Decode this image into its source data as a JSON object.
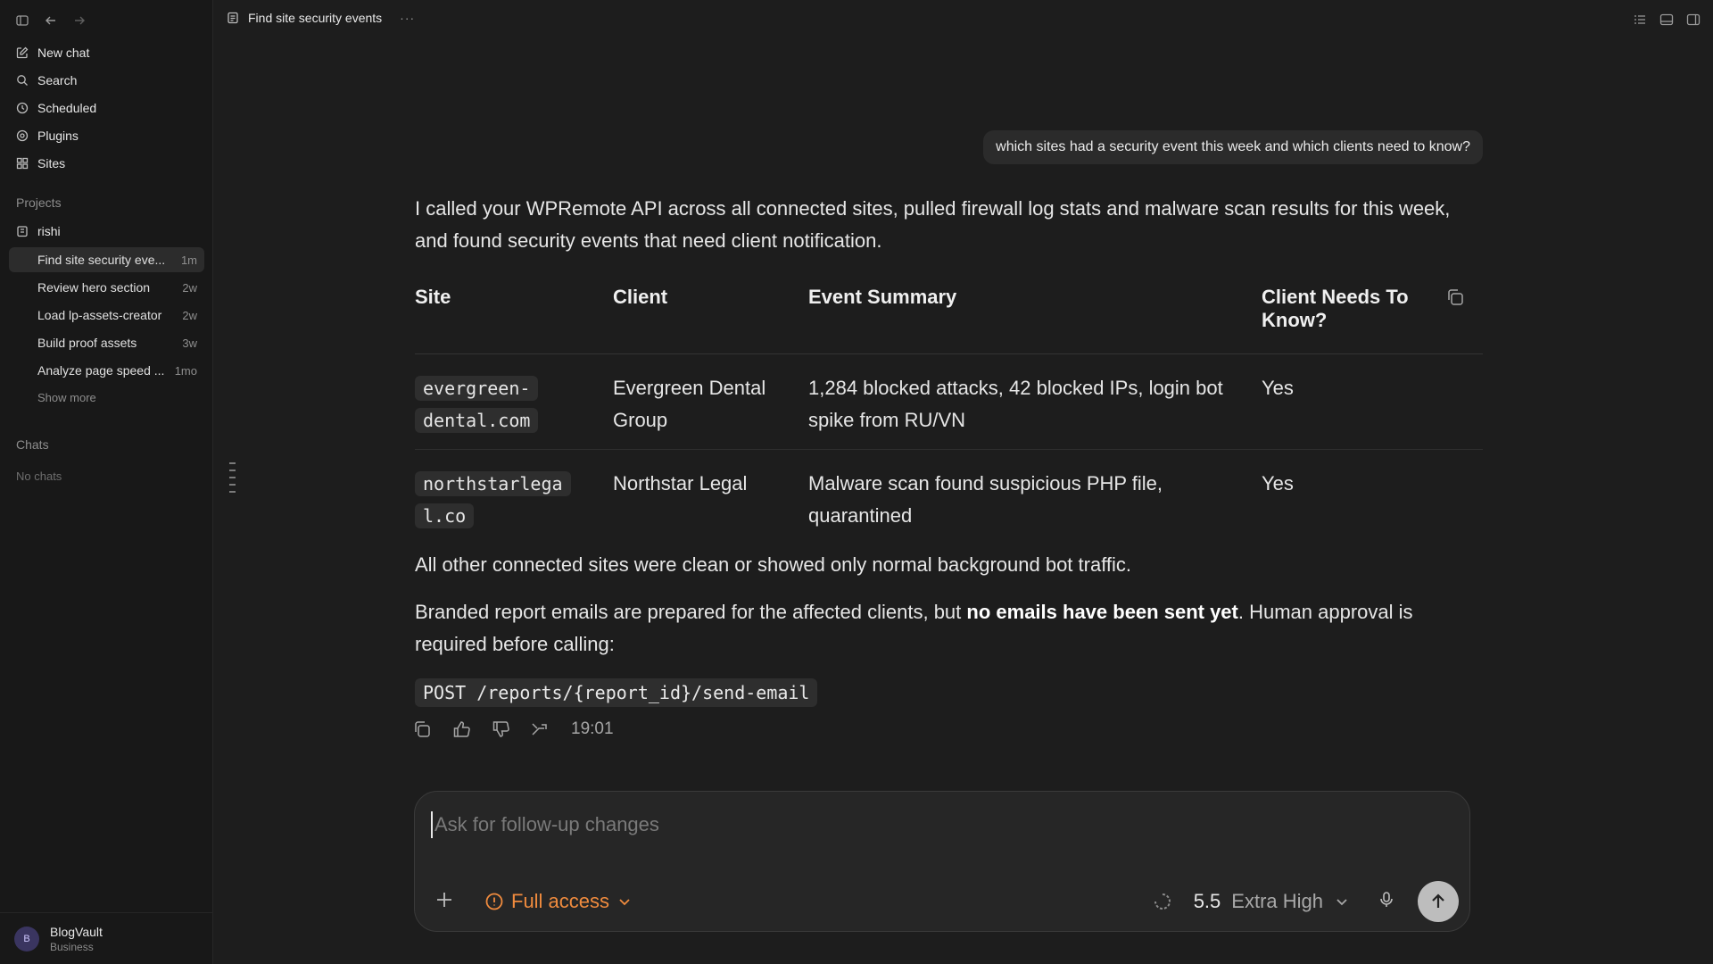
{
  "sidebar": {
    "nav": [
      {
        "label": "New chat",
        "icon": "edit-icon"
      },
      {
        "label": "Search",
        "icon": "search-icon"
      },
      {
        "label": "Scheduled",
        "icon": "clock-icon"
      },
      {
        "label": "Plugins",
        "icon": "plugin-icon"
      },
      {
        "label": "Sites",
        "icon": "grid-icon"
      }
    ],
    "projects_label": "Projects",
    "project_name": "rishi",
    "threads": [
      {
        "title": "Find site security eve...",
        "age": "1m",
        "active": true
      },
      {
        "title": "Review hero section",
        "age": "2w",
        "active": false
      },
      {
        "title": "Load lp-assets-creator",
        "age": "2w",
        "active": false
      },
      {
        "title": "Build proof assets",
        "age": "3w",
        "active": false
      },
      {
        "title": "Analyze page speed ...",
        "age": "1mo",
        "active": false
      }
    ],
    "show_more": "Show more",
    "chats_label": "Chats",
    "no_chats": "No chats",
    "account": {
      "initial": "B",
      "name": "BlogVault",
      "plan": "Business"
    }
  },
  "header": {
    "title": "Find site security events",
    "more": "···"
  },
  "conversation": {
    "user_message": "which sites had a security event this week and which clients need to know?",
    "intro": "I called your WPRemote API across all connected sites, pulled firewall log stats and malware scan results for this week, and found security events that need client notification.",
    "table": {
      "headers": [
        "Site",
        "Client",
        "Event Summary",
        "Client Needs To Know?"
      ],
      "rows": [
        {
          "site_line1": "evergreen-",
          "site_line2": "dental.com",
          "client": "Evergreen Dental Group",
          "summary": "1,284 blocked attacks, 42 blocked IPs, login bot spike from RU/VN",
          "notify": "Yes"
        },
        {
          "site_line1": "northstarlega",
          "site_line2": "l.co",
          "client": "Northstar Legal",
          "summary": "Malware scan found suspicious PHP file, quarantined",
          "notify": "Yes"
        }
      ]
    },
    "clean_note": "All other connected sites were clean or showed only normal background bot traffic.",
    "report_pre": "Branded report emails are prepared for the affected clients, but ",
    "report_bold": "no emails have been sent yet",
    "report_post": ". Human approval is required before calling:",
    "endpoint": "POST /reports/{report_id}/send-email",
    "timestamp": "19:01"
  },
  "composer": {
    "placeholder": "Ask for follow-up changes",
    "access_label": "Full access",
    "model_version": "5.5",
    "model_mode": "Extra High"
  },
  "colors": {
    "accent_orange": "#f08b3e",
    "bg": "#1d1d1d",
    "sidebar_bg": "#181818"
  }
}
